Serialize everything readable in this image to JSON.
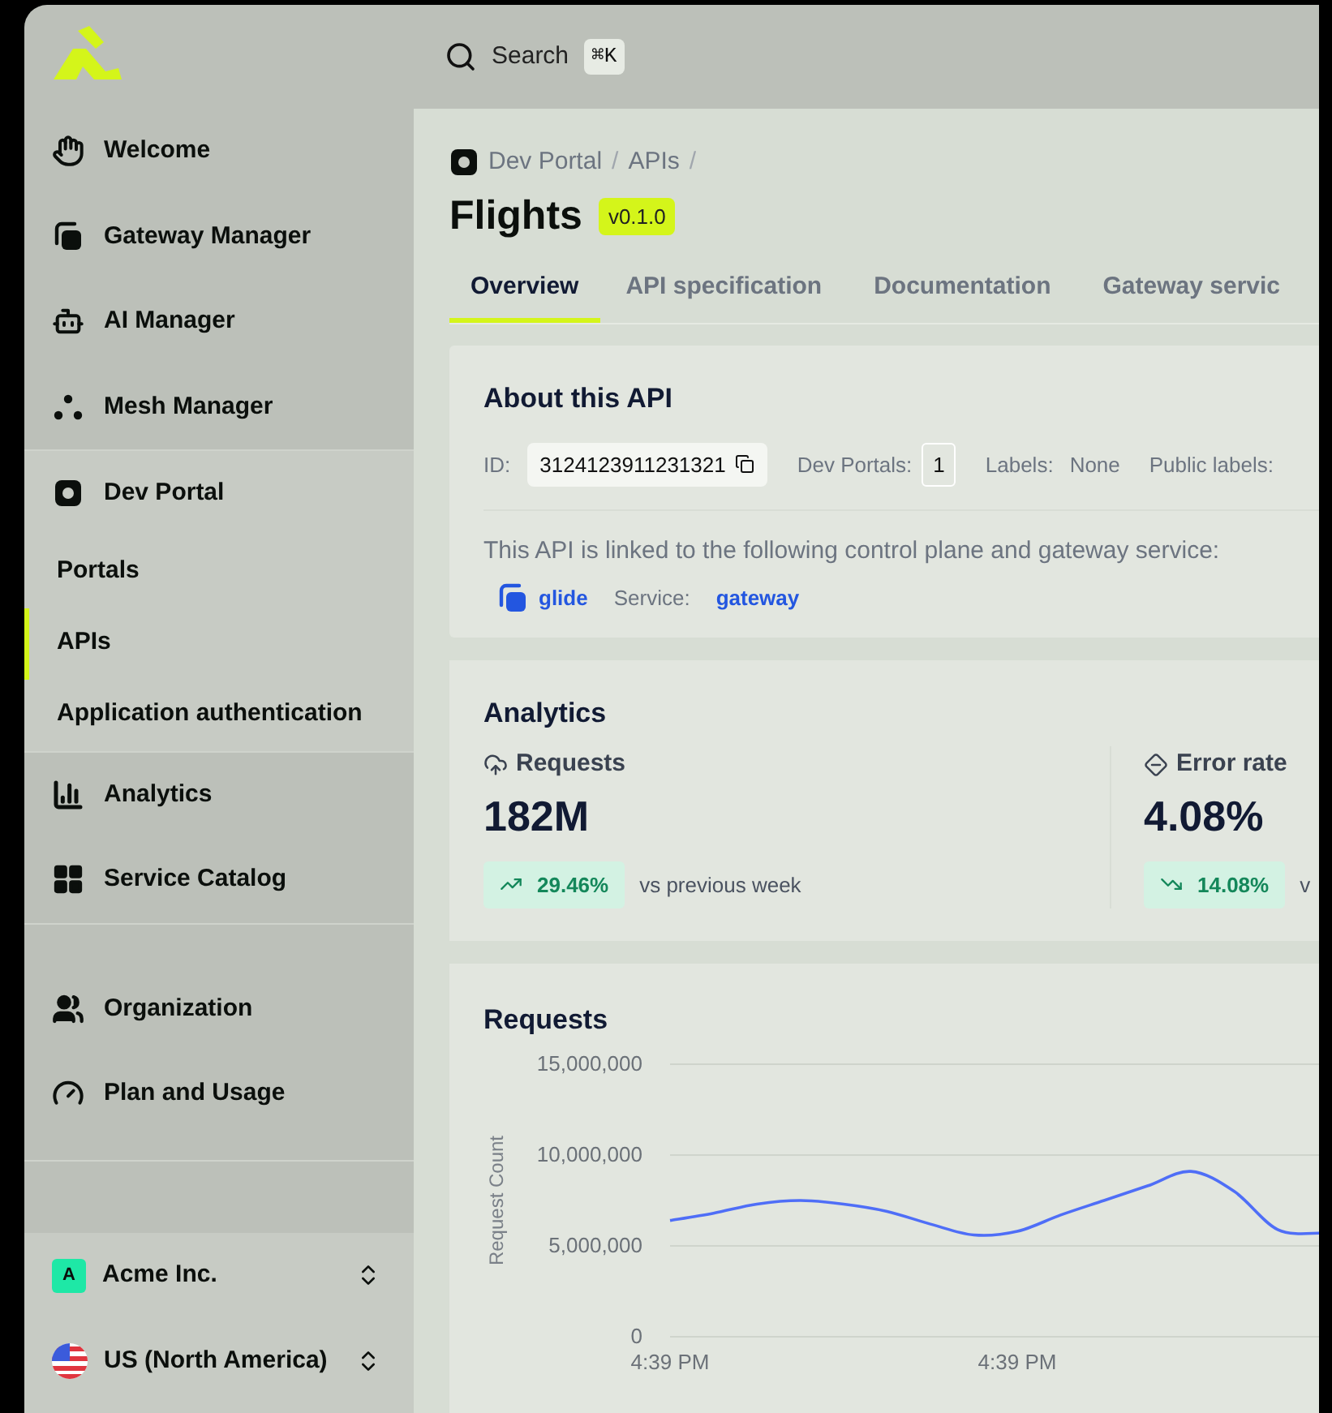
{
  "topbar": {
    "search": {
      "placeholder": "Search",
      "shortcut": "⌘K"
    }
  },
  "sidebar": {
    "groups": [
      {
        "items": [
          {
            "label": "Welcome",
            "kind": "nav",
            "selected": false
          },
          {
            "label": "Gateway Manager",
            "kind": "nav",
            "selected": false
          },
          {
            "label": "AI Manager",
            "kind": "nav",
            "selected": false
          },
          {
            "label": "Mesh Manager",
            "kind": "nav",
            "selected": false
          }
        ]
      },
      {
        "items": [
          {
            "label": "Dev Portal",
            "kind": "nav",
            "selected": false,
            "children": [
              {
                "label": "Portals",
                "selected": false
              },
              {
                "label": "APIs",
                "selected": true
              },
              {
                "label": "Application authentication",
                "selected": false
              }
            ]
          }
        ]
      },
      {
        "items": [
          {
            "label": "Analytics",
            "kind": "nav",
            "selected": false
          },
          {
            "label": "Service Catalog",
            "kind": "nav",
            "selected": false
          }
        ]
      },
      {
        "items": [
          {
            "label": "Organization",
            "kind": "nav",
            "selected": false
          },
          {
            "label": "Plan and Usage",
            "kind": "nav",
            "selected": false
          }
        ]
      }
    ],
    "footer": [
      {
        "kind": "org",
        "badge": "A",
        "label": "Acme Inc."
      },
      {
        "kind": "region",
        "label": "US (North America)"
      }
    ]
  },
  "breadcrumb": {
    "items": [
      "Dev Portal",
      "APIs"
    ],
    "separator": "/"
  },
  "title": "Flights",
  "version": "v0.1.0",
  "tabs": [
    {
      "label": "Overview",
      "selected": true
    },
    {
      "label": "API specification",
      "selected": false
    },
    {
      "label": "Documentation",
      "selected": false
    },
    {
      "label": "Gateway servic",
      "selected": false
    }
  ],
  "about": {
    "title": "About this API",
    "id_label": "ID:",
    "id": "3124123911231321",
    "portals_label": "Dev Portals:",
    "portals": "1",
    "labels_label": "Labels:",
    "labels": "None",
    "public_labels_label": "Public labels:",
    "linked_text": "This API is linked to the following control plane and gateway service:",
    "control_plane": "glide",
    "service_label": "Service:",
    "service": "gateway"
  },
  "analytics": {
    "title": "Analytics",
    "metrics": [
      {
        "kind": "requests",
        "label": "Requests",
        "value": "182M",
        "delta": "29.46%",
        "trending_up": true,
        "compare": "vs previous week"
      },
      {
        "kind": "errors",
        "label": "Error rate",
        "value": "4.08%",
        "delta": "14.08%",
        "trending_up": false,
        "compare": "v"
      }
    ]
  },
  "requests": {
    "title": "Requests",
    "chart_data": {
      "type": "line",
      "ylabel": "Request Count",
      "categories": [
        "4:39 PM",
        null,
        null,
        null,
        null,
        null,
        null,
        null,
        "4:39 PM",
        null,
        null,
        null,
        null,
        null,
        null,
        null
      ],
      "series": [
        {
          "color": "#4f6ef7",
          "values": [
            6400000,
            6800000,
            7300000,
            7500000,
            7300000,
            6900000,
            6200000,
            5600000,
            5800000,
            6700000,
            7500000,
            8300000,
            9100000,
            8000000,
            5900000,
            5700000
          ]
        }
      ],
      "ylim": [
        0,
        15000000
      ],
      "yticks": [
        {
          "value": 0,
          "label": "0"
        },
        {
          "value": 5000000,
          "label": "5,000,000"
        },
        {
          "value": 10000000,
          "label": "10,000,000"
        },
        {
          "value": 15000000,
          "label": "15,000,000"
        }
      ]
    }
  }
}
